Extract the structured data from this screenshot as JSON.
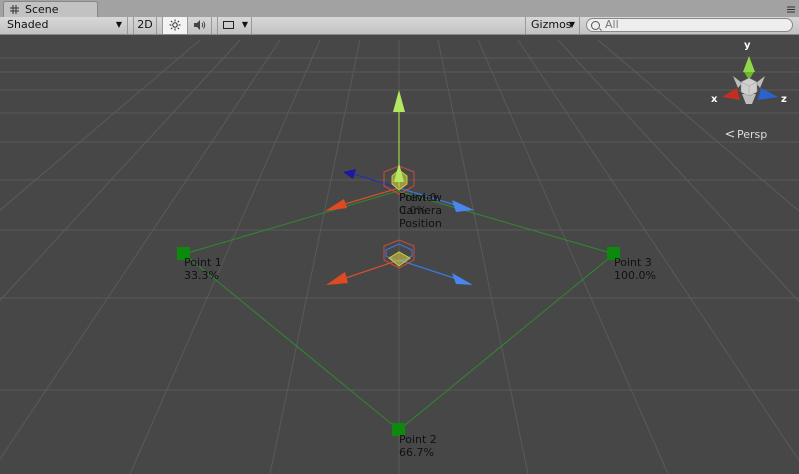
{
  "window": {
    "tab_title": "Scene"
  },
  "toolbar": {
    "shading_mode": "Shaded",
    "btn_2d": "2D",
    "light_icon": "sun-icon",
    "audio_icon": "speaker-icon",
    "effects_icon": "image-icon",
    "gizmos_label": "Gizmos",
    "search_placeholder": "All"
  },
  "orientation_gizmo": {
    "y": "y",
    "x": "x",
    "z": "z",
    "projection": "Persp"
  },
  "handles": {
    "preview_overlap_1": "Preview",
    "preview_overlap_2": "Camera",
    "preview_overlap_3": "Position",
    "preview_progress_label": "Point 0",
    "preview_progress_value": "0.0%"
  },
  "points": [
    {
      "name": "Point 1",
      "percent": "33.3%"
    },
    {
      "name": "Point 2",
      "percent": "66.7%"
    },
    {
      "name": "Point 3",
      "percent": "100.0%"
    }
  ],
  "colors": {
    "x_axis": "#d8502a",
    "y_axis": "#9fd44a",
    "z_axis": "#3a78e0",
    "path_line": "#2f8a2f",
    "point_marker": "#0d8a0d"
  }
}
